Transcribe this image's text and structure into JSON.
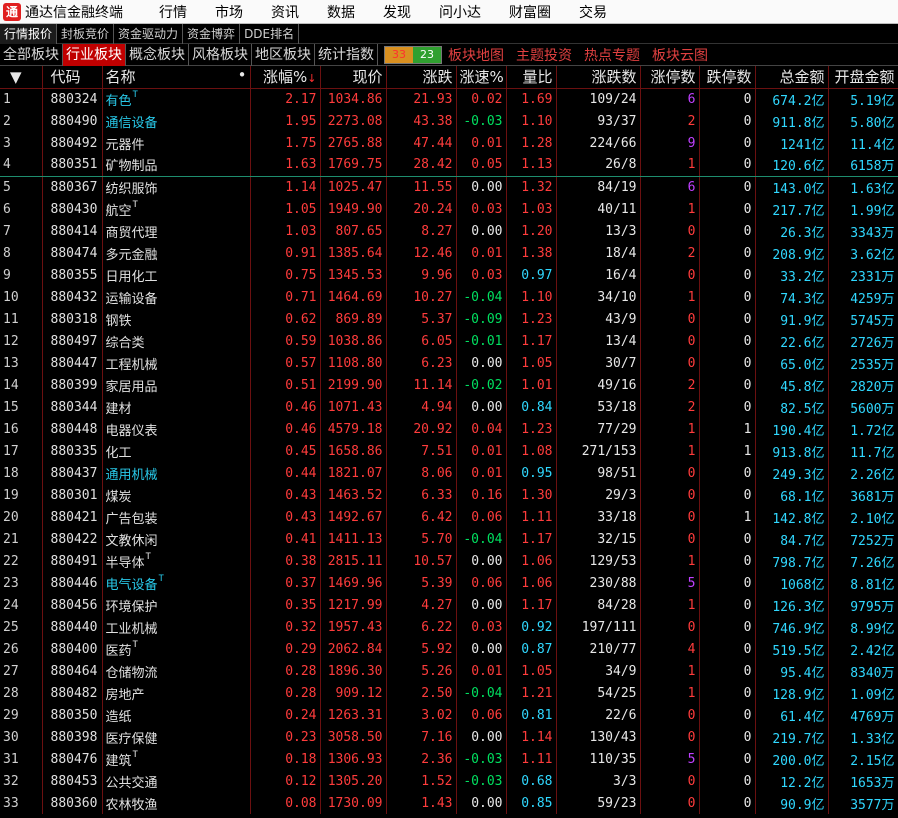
{
  "app": {
    "title": "通达信金融终端",
    "logo": "通"
  },
  "menu": [
    "行情",
    "市场",
    "资讯",
    "数据",
    "发现",
    "问小达",
    "财富圈",
    "交易"
  ],
  "subtabs": [
    "行情报价",
    "封板竞价",
    "资金驱动力",
    "资金博弈",
    "DDE排名"
  ],
  "block_tabs": [
    "全部板块",
    "行业板块",
    "概念板块",
    "风格板块",
    "地区板块",
    "统计指数"
  ],
  "counts": {
    "up": "33",
    "down": "23"
  },
  "links": [
    "板块地图",
    "主题投资",
    "热点专题",
    "板块云图"
  ],
  "columns": {
    "idx": "▼",
    "code": "代码",
    "name": "名称",
    "name_dot": "•",
    "pct": "涨幅%",
    "sort_arrow": "↓",
    "price": "现价",
    "chg": "涨跌",
    "speed": "涨速%",
    "vr": "量比",
    "updown": "涨跌数",
    "limitup": "涨停数",
    "limitdown": "跌停数",
    "amount": "总金额",
    "open_amt": "开盘金额"
  },
  "rows": [
    {
      "idx": "1",
      "code": "880324",
      "name": "有色",
      "t": true,
      "cyan": true,
      "pct": "2.17",
      "price": "1034.86",
      "chg": "21.93",
      "speed": "0.02",
      "vr": "1.69",
      "updown": "109/24",
      "lu": "6",
      "ld": "0",
      "amt": "674.2亿",
      "open": "5.19亿"
    },
    {
      "idx": "2",
      "code": "880490",
      "name": "通信设备",
      "t": false,
      "cyan": true,
      "pct": "1.95",
      "price": "2273.08",
      "chg": "43.38",
      "speed": "-0.03",
      "vr": "1.10",
      "updown": "93/37",
      "lu": "2",
      "ld": "0",
      "amt": "911.8亿",
      "open": "5.80亿"
    },
    {
      "idx": "3",
      "code": "880492",
      "name": "元器件",
      "t": false,
      "cyan": false,
      "pct": "1.75",
      "price": "2765.88",
      "chg": "47.44",
      "speed": "0.01",
      "vr": "1.28",
      "updown": "224/66",
      "lu": "9",
      "ld": "0",
      "amt": "1241亿",
      "open": "11.4亿"
    },
    {
      "idx": "4",
      "code": "880351",
      "name": "矿物制品",
      "t": false,
      "cyan": false,
      "pct": "1.63",
      "price": "1769.75",
      "chg": "28.42",
      "speed": "0.05",
      "vr": "1.13",
      "updown": "26/8",
      "lu": "1",
      "ld": "0",
      "amt": "120.6亿",
      "open": "6158万"
    },
    {
      "idx": "5",
      "code": "880367",
      "name": "纺织服饰",
      "t": false,
      "cyan": false,
      "pct": "1.14",
      "price": "1025.47",
      "chg": "11.55",
      "speed": "0.00",
      "vr": "1.32",
      "updown": "84/19",
      "lu": "6",
      "ld": "0",
      "amt": "143.0亿",
      "open": "1.63亿"
    },
    {
      "idx": "6",
      "code": "880430",
      "name": "航空",
      "t": true,
      "cyan": false,
      "pct": "1.05",
      "price": "1949.90",
      "chg": "20.24",
      "speed": "0.03",
      "vr": "1.03",
      "updown": "40/11",
      "lu": "1",
      "ld": "0",
      "amt": "217.7亿",
      "open": "1.99亿"
    },
    {
      "idx": "7",
      "code": "880414",
      "name": "商贸代理",
      "t": false,
      "cyan": false,
      "pct": "1.03",
      "price": "807.65",
      "chg": "8.27",
      "speed": "0.00",
      "vr": "1.20",
      "updown": "13/3",
      "lu": "0",
      "ld": "0",
      "amt": "26.3亿",
      "open": "3343万"
    },
    {
      "idx": "8",
      "code": "880474",
      "name": "多元金融",
      "t": false,
      "cyan": false,
      "pct": "0.91",
      "price": "1385.64",
      "chg": "12.46",
      "speed": "0.01",
      "vr": "1.38",
      "updown": "18/4",
      "lu": "2",
      "ld": "0",
      "amt": "208.9亿",
      "open": "3.62亿"
    },
    {
      "idx": "9",
      "code": "880355",
      "name": "日用化工",
      "t": false,
      "cyan": false,
      "pct": "0.75",
      "price": "1345.53",
      "chg": "9.96",
      "speed": "0.03",
      "vr": "0.97",
      "updown": "16/4",
      "lu": "0",
      "ld": "0",
      "amt": "33.2亿",
      "open": "2331万"
    },
    {
      "idx": "10",
      "code": "880432",
      "name": "运输设备",
      "t": false,
      "cyan": false,
      "pct": "0.71",
      "price": "1464.69",
      "chg": "10.27",
      "speed": "-0.04",
      "vr": "1.10",
      "updown": "34/10",
      "lu": "1",
      "ld": "0",
      "amt": "74.3亿",
      "open": "4259万"
    },
    {
      "idx": "11",
      "code": "880318",
      "name": "钢铁",
      "t": false,
      "cyan": false,
      "pct": "0.62",
      "price": "869.89",
      "chg": "5.37",
      "speed": "-0.09",
      "vr": "1.23",
      "updown": "43/9",
      "lu": "0",
      "ld": "0",
      "amt": "91.9亿",
      "open": "5745万"
    },
    {
      "idx": "12",
      "code": "880497",
      "name": "综合类",
      "t": false,
      "cyan": false,
      "pct": "0.59",
      "price": "1038.86",
      "chg": "6.05",
      "speed": "-0.01",
      "vr": "1.17",
      "updown": "13/4",
      "lu": "0",
      "ld": "0",
      "amt": "22.6亿",
      "open": "2726万"
    },
    {
      "idx": "13",
      "code": "880447",
      "name": "工程机械",
      "t": false,
      "cyan": false,
      "pct": "0.57",
      "price": "1108.80",
      "chg": "6.23",
      "speed": "0.00",
      "vr": "1.05",
      "updown": "30/7",
      "lu": "0",
      "ld": "0",
      "amt": "65.0亿",
      "open": "2535万"
    },
    {
      "idx": "14",
      "code": "880399",
      "name": "家居用品",
      "t": false,
      "cyan": false,
      "pct": "0.51",
      "price": "2199.90",
      "chg": "11.14",
      "speed": "-0.02",
      "vr": "1.01",
      "updown": "49/16",
      "lu": "2",
      "ld": "0",
      "amt": "45.8亿",
      "open": "2820万"
    },
    {
      "idx": "15",
      "code": "880344",
      "name": "建材",
      "t": false,
      "cyan": false,
      "pct": "0.46",
      "price": "1071.43",
      "chg": "4.94",
      "speed": "0.00",
      "vr": "0.84",
      "updown": "53/18",
      "lu": "2",
      "ld": "0",
      "amt": "82.5亿",
      "open": "5600万"
    },
    {
      "idx": "16",
      "code": "880448",
      "name": "电器仪表",
      "t": false,
      "cyan": false,
      "pct": "0.46",
      "price": "4579.18",
      "chg": "20.92",
      "speed": "0.04",
      "vr": "1.23",
      "updown": "77/29",
      "lu": "1",
      "ld": "1",
      "amt": "190.4亿",
      "open": "1.72亿"
    },
    {
      "idx": "17",
      "code": "880335",
      "name": "化工",
      "t": false,
      "cyan": false,
      "pct": "0.45",
      "price": "1658.86",
      "chg": "7.51",
      "speed": "0.01",
      "vr": "1.08",
      "updown": "271/153",
      "lu": "1",
      "ld": "1",
      "amt": "913.8亿",
      "open": "11.7亿"
    },
    {
      "idx": "18",
      "code": "880437",
      "name": "通用机械",
      "t": false,
      "cyan": true,
      "pct": "0.44",
      "price": "1821.07",
      "chg": "8.06",
      "speed": "0.01",
      "vr": "0.95",
      "updown": "98/51",
      "lu": "0",
      "ld": "0",
      "amt": "249.3亿",
      "open": "2.26亿"
    },
    {
      "idx": "19",
      "code": "880301",
      "name": "煤炭",
      "t": false,
      "cyan": false,
      "pct": "0.43",
      "price": "1463.52",
      "chg": "6.33",
      "speed": "0.16",
      "vr": "1.30",
      "updown": "29/3",
      "lu": "0",
      "ld": "0",
      "amt": "68.1亿",
      "open": "3681万"
    },
    {
      "idx": "20",
      "code": "880421",
      "name": "广告包装",
      "t": false,
      "cyan": false,
      "pct": "0.43",
      "price": "1492.67",
      "chg": "6.42",
      "speed": "0.06",
      "vr": "1.11",
      "updown": "33/18",
      "lu": "0",
      "ld": "1",
      "amt": "142.8亿",
      "open": "2.10亿"
    },
    {
      "idx": "21",
      "code": "880422",
      "name": "文教休闲",
      "t": false,
      "cyan": false,
      "pct": "0.41",
      "price": "1411.13",
      "chg": "5.70",
      "speed": "-0.04",
      "vr": "1.17",
      "updown": "32/15",
      "lu": "0",
      "ld": "0",
      "amt": "84.7亿",
      "open": "7252万"
    },
    {
      "idx": "22",
      "code": "880491",
      "name": "半导体",
      "t": true,
      "cyan": false,
      "pct": "0.38",
      "price": "2815.11",
      "chg": "10.57",
      "speed": "0.00",
      "vr": "1.06",
      "updown": "129/53",
      "lu": "1",
      "ld": "0",
      "amt": "798.7亿",
      "open": "7.26亿"
    },
    {
      "idx": "23",
      "code": "880446",
      "name": "电气设备",
      "t": true,
      "cyan": true,
      "pct": "0.37",
      "price": "1469.96",
      "chg": "5.39",
      "speed": "0.06",
      "vr": "1.06",
      "updown": "230/88",
      "lu": "5",
      "ld": "0",
      "amt": "1068亿",
      "open": "8.81亿"
    },
    {
      "idx": "24",
      "code": "880456",
      "name": "环境保护",
      "t": false,
      "cyan": false,
      "pct": "0.35",
      "price": "1217.99",
      "chg": "4.27",
      "speed": "0.00",
      "vr": "1.17",
      "updown": "84/28",
      "lu": "1",
      "ld": "0",
      "amt": "126.3亿",
      "open": "9795万"
    },
    {
      "idx": "25",
      "code": "880440",
      "name": "工业机械",
      "t": false,
      "cyan": false,
      "pct": "0.32",
      "price": "1957.43",
      "chg": "6.22",
      "speed": "0.03",
      "vr": "0.92",
      "updown": "197/111",
      "lu": "0",
      "ld": "0",
      "amt": "746.9亿",
      "open": "8.99亿"
    },
    {
      "idx": "26",
      "code": "880400",
      "name": "医药",
      "t": true,
      "cyan": false,
      "pct": "0.29",
      "price": "2062.84",
      "chg": "5.92",
      "speed": "0.00",
      "vr": "0.87",
      "updown": "210/77",
      "lu": "4",
      "ld": "0",
      "amt": "519.5亿",
      "open": "2.42亿"
    },
    {
      "idx": "27",
      "code": "880464",
      "name": "仓储物流",
      "t": false,
      "cyan": false,
      "pct": "0.28",
      "price": "1896.30",
      "chg": "5.26",
      "speed": "0.01",
      "vr": "1.05",
      "updown": "34/9",
      "lu": "1",
      "ld": "0",
      "amt": "95.4亿",
      "open": "8340万"
    },
    {
      "idx": "28",
      "code": "880482",
      "name": "房地产",
      "t": false,
      "cyan": false,
      "pct": "0.28",
      "price": "909.12",
      "chg": "2.50",
      "speed": "-0.04",
      "vr": "1.21",
      "updown": "54/25",
      "lu": "1",
      "ld": "0",
      "amt": "128.9亿",
      "open": "1.09亿"
    },
    {
      "idx": "29",
      "code": "880350",
      "name": "造纸",
      "t": false,
      "cyan": false,
      "pct": "0.24",
      "price": "1263.31",
      "chg": "3.02",
      "speed": "0.06",
      "vr": "0.81",
      "updown": "22/6",
      "lu": "0",
      "ld": "0",
      "amt": "61.4亿",
      "open": "4769万"
    },
    {
      "idx": "30",
      "code": "880398",
      "name": "医疗保健",
      "t": false,
      "cyan": false,
      "pct": "0.23",
      "price": "3058.50",
      "chg": "7.16",
      "speed": "0.00",
      "vr": "1.14",
      "updown": "130/43",
      "lu": "0",
      "ld": "0",
      "amt": "219.7亿",
      "open": "1.33亿"
    },
    {
      "idx": "31",
      "code": "880476",
      "name": "建筑",
      "t": true,
      "cyan": false,
      "pct": "0.18",
      "price": "1306.93",
      "chg": "2.36",
      "speed": "-0.03",
      "vr": "1.11",
      "updown": "110/35",
      "lu": "5",
      "ld": "0",
      "amt": "200.0亿",
      "open": "2.15亿"
    },
    {
      "idx": "32",
      "code": "880453",
      "name": "公共交通",
      "t": false,
      "cyan": false,
      "pct": "0.12",
      "price": "1305.20",
      "chg": "1.52",
      "speed": "-0.03",
      "vr": "0.68",
      "updown": "3/3",
      "lu": "0",
      "ld": "0",
      "amt": "12.2亿",
      "open": "1653万"
    },
    {
      "idx": "33",
      "code": "880360",
      "name": "农林牧渔",
      "t": false,
      "cyan": false,
      "pct": "0.08",
      "price": "1730.09",
      "chg": "1.43",
      "speed": "0.00",
      "vr": "0.85",
      "updown": "59/23",
      "lu": "0",
      "ld": "0",
      "amt": "90.9亿",
      "open": "3577万"
    }
  ]
}
